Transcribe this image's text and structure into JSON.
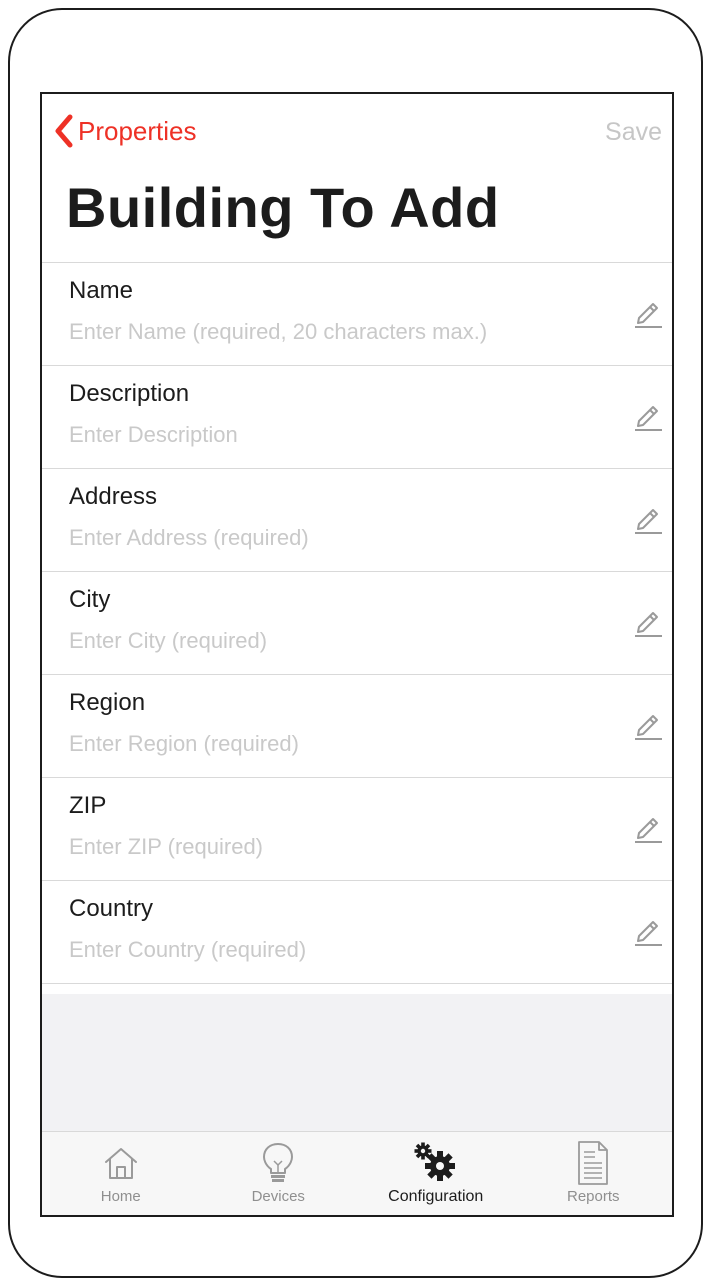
{
  "colors": {
    "accent": "#ee3126",
    "placeholder": "#c9c9c9",
    "inactive_tab": "#8f8f8f",
    "background_gray": "#f2f2f4"
  },
  "navbar": {
    "back_label": "Properties",
    "back_icon": "chevron-left-icon",
    "save_label": "Save",
    "title": "Building To Add"
  },
  "form": {
    "fields": [
      {
        "label": "Name",
        "value": "",
        "placeholder": "Enter Name (required, 20 characters max.)",
        "icon": "pencil-icon"
      },
      {
        "label": "Description",
        "value": "",
        "placeholder": "Enter Description",
        "icon": "pencil-icon"
      },
      {
        "label": "Address",
        "value": "",
        "placeholder": "Enter Address (required)",
        "icon": "pencil-icon"
      },
      {
        "label": "City",
        "value": "",
        "placeholder": "Enter City (required)",
        "icon": "pencil-icon"
      },
      {
        "label": "Region",
        "value": "",
        "placeholder": "Enter Region (required)",
        "icon": "pencil-icon"
      },
      {
        "label": "ZIP",
        "value": "",
        "placeholder": "Enter ZIP (required)",
        "icon": "pencil-icon"
      },
      {
        "label": "Country",
        "value": "",
        "placeholder": "Enter Country (required)",
        "icon": "pencil-icon"
      }
    ]
  },
  "tabbar": {
    "tabs": [
      {
        "label": "Home",
        "icon": "home-icon",
        "active": false
      },
      {
        "label": "Devices",
        "icon": "lightbulb-icon",
        "active": false
      },
      {
        "label": "Configuration",
        "icon": "gears-icon",
        "active": true
      },
      {
        "label": "Reports",
        "icon": "document-icon",
        "active": false
      }
    ]
  }
}
